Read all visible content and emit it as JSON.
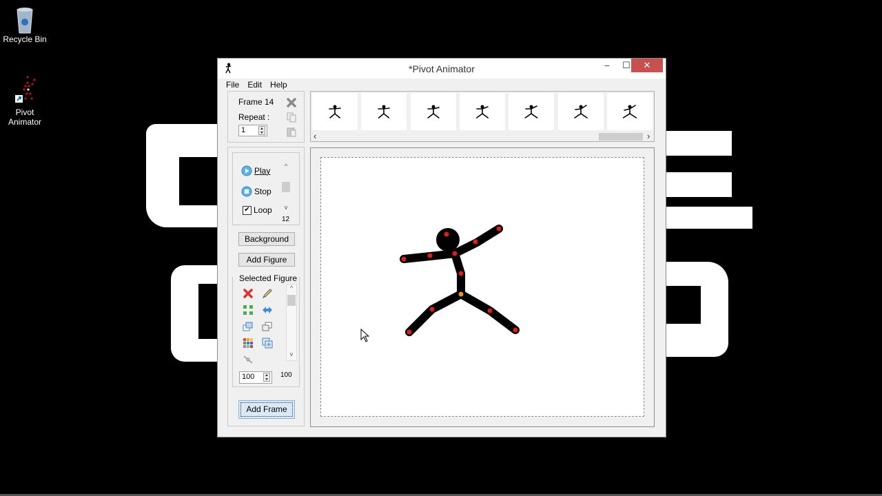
{
  "desktop": {
    "icons": [
      {
        "label": "Recycle Bin",
        "icon": "recycle-bin-icon"
      },
      {
        "label": "Pivot Animator",
        "icon": "pivot-shortcut-icon"
      }
    ],
    "wallpaper_text": "graffiti-letters"
  },
  "window": {
    "title": "*Pivot Animator",
    "controls": {
      "minimize": "–",
      "maximize": "☐",
      "close": "✕"
    },
    "menu": [
      "File",
      "Edit",
      "Help"
    ]
  },
  "frame_panel": {
    "frame_label": "Frame 14",
    "repeat_label": "Repeat :",
    "repeat_value": "1",
    "icons": [
      "delete-frame-icon",
      "copy-frame-icon",
      "paste-frame-icon"
    ]
  },
  "playback": {
    "play_label": "Play",
    "stop_label": "Stop",
    "loop_label": "Loop",
    "loop_checked": true,
    "speed_value": "12"
  },
  "buttons": {
    "background": "Background",
    "add_figure": "Add Figure",
    "add_frame": "Add Frame"
  },
  "selected_figure": {
    "label": "Selected Figure",
    "tools": [
      "delete-figure-icon",
      "edit-figure-icon",
      "center-figure-icon",
      "flip-figure-icon",
      "bring-front-icon",
      "send-back-icon",
      "color-palette-icon",
      "duplicate-figure-icon",
      "join-icon"
    ],
    "size_value": "100",
    "size_readout": "100"
  },
  "timeline": {
    "frame_count_visible": 7,
    "scroll_left": "‹",
    "scroll_right": "›"
  },
  "colors": {
    "close_button": "#c75050",
    "joint_red": "#e01c1c",
    "joint_orange": "#e8922a",
    "figure": "#000000",
    "window_bg": "#f0f0f0"
  }
}
